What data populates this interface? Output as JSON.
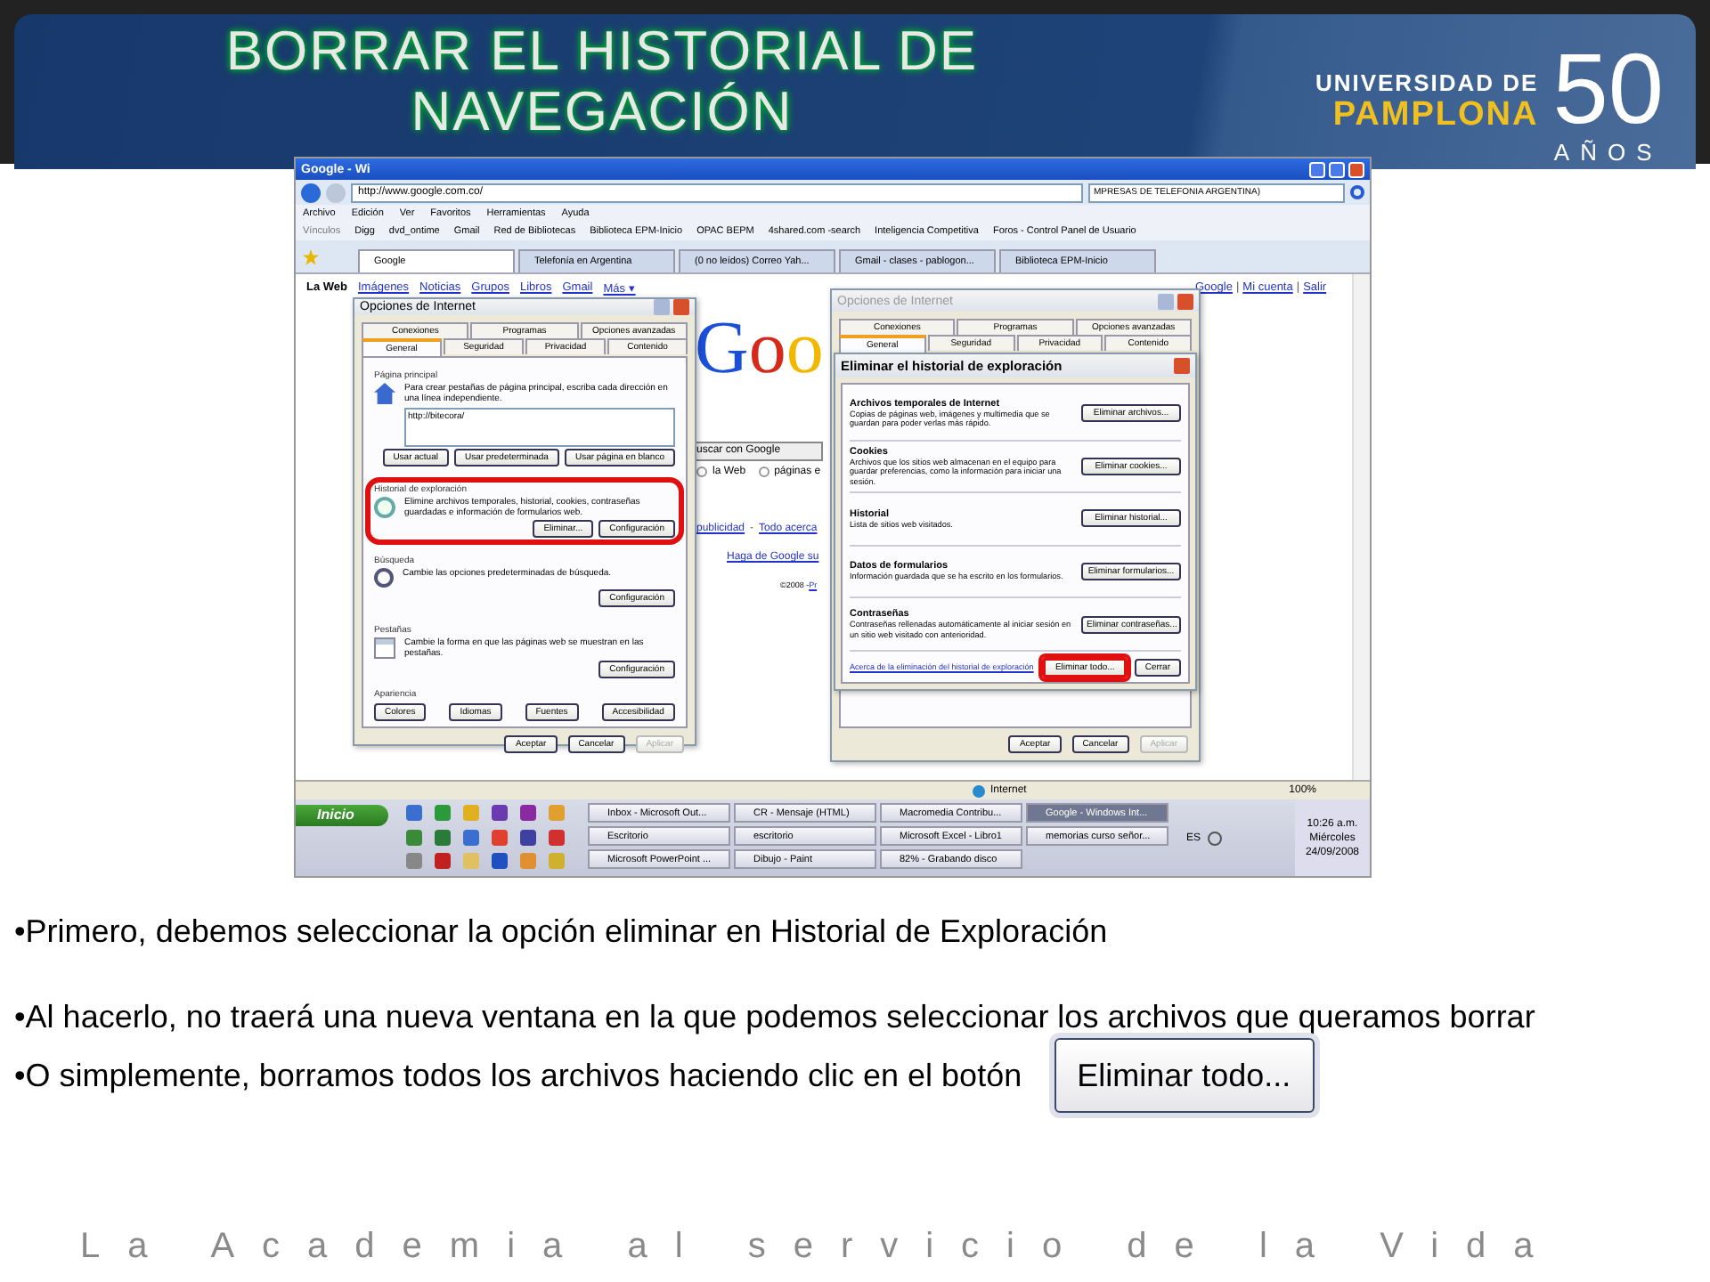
{
  "header": {
    "title": "BORRAR EL HISTORIAL DE NAVEGACIÓN",
    "logo": {
      "line1": "UNIVERSIDAD DE",
      "line2": "PAMPLONA",
      "number": "50",
      "years": "AÑOS"
    }
  },
  "screenshot": {
    "browser": {
      "title": "Google - Wi",
      "address": "http://www.google.com.co/",
      "search": "MPRESAS DE TELEFONIA ARGENTINA)",
      "menu": [
        "Archivo",
        "Edición",
        "Ver",
        "Favoritos",
        "Herramientas",
        "Ayuda"
      ],
      "links_label": "Vínculos",
      "links": [
        "Digg",
        "dvd_ontime",
        "Gmail",
        "Red de Bibliotecas",
        "Biblioteca EPM-Inicio",
        "OPAC BEPM",
        "4shared.com -search",
        "Inteligencia Competitiva",
        "Foros - Control Panel de Usuario"
      ],
      "tabs": [
        {
          "label": "Google",
          "selected": true
        },
        {
          "label": "Telefonía en Argentina",
          "selected": false
        },
        {
          "label": "(0 no leídos) Correo Yah...",
          "selected": false
        },
        {
          "label": "Gmail - clases - pablogon...",
          "selected": false
        },
        {
          "label": "Biblioteca EPM-Inicio",
          "selected": false
        }
      ],
      "status": "Internet",
      "zoom": "100%"
    },
    "page": {
      "nav": [
        {
          "label": "La Web",
          "selected": true
        },
        {
          "label": "Imágenes",
          "selected": false
        },
        {
          "label": "Noticias",
          "selected": false
        },
        {
          "label": "Grupos",
          "selected": false
        },
        {
          "label": "Libros",
          "selected": false
        },
        {
          "label": "Gmail",
          "selected": false
        },
        {
          "label": "Más ▾",
          "selected": false
        }
      ],
      "account_links": [
        "Google",
        "Mi cuenta",
        "Salir"
      ],
      "account_separator": "|",
      "logo": "Goo",
      "search_button": "uscar con Google",
      "radios": [
        {
          "label": "la Web",
          "selected": false
        },
        {
          "label": "páginas e",
          "selected": false
        }
      ],
      "links": [
        "publicidad",
        "Todo acerca"
      ],
      "link_separator": "-",
      "homepage_link": "Haga de Google su",
      "copyright": "©2008 - ",
      "copyright_link": "Pr"
    },
    "dialogs": [
      {
        "kind": "options",
        "title": "Opciones de Internet",
        "active": true,
        "tab_rows": [
          [
            {
              "label": "Conexiones",
              "selected": false
            },
            {
              "label": "Programas",
              "selected": false
            },
            {
              "label": "Opciones avanzadas",
              "selected": false
            }
          ],
          [
            {
              "label": "General",
              "selected": true
            },
            {
              "label": "Seguridad",
              "selected": false
            },
            {
              "label": "Privacidad",
              "selected": false
            },
            {
              "label": "Contenido",
              "selected": false
            }
          ]
        ],
        "sections": [
          {
            "heading": "Página principal",
            "text": "Para crear pestañas de página principal, escriba cada dirección en una línea independiente.",
            "value": "http://bitecora/",
            "buttons": [
              "Usar actual",
              "Usar predeterminada",
              "Usar página en blanco"
            ],
            "highlighted": false
          },
          {
            "heading": "Historial de exploración",
            "text": "Elimine archivos temporales, historial, cookies, contraseñas guardadas e información de formularios web.",
            "buttons": [
              "Eliminar...",
              "Configuración"
            ],
            "highlighted": true
          },
          {
            "heading": "Búsqueda",
            "text": "Cambie las opciones predeterminadas de búsqueda.",
            "buttons": [
              "Configuración"
            ],
            "highlighted": false
          },
          {
            "heading": "Pestañas",
            "text": "Cambie la forma en que las páginas web se muestran en las pestañas.",
            "buttons": [
              "Configuración"
            ],
            "highlighted": false
          }
        ],
        "appearance": {
          "heading": "Apariencia",
          "buttons": [
            "Colores",
            "Idiomas",
            "Fuentes",
            "Accesibilidad"
          ]
        },
        "footer": [
          {
            "label": "Aceptar",
            "disabled": false
          },
          {
            "label": "Cancelar",
            "disabled": false
          },
          {
            "label": "Aplicar",
            "disabled": true
          }
        ]
      },
      {
        "kind": "options_behind",
        "title": "Opciones de Internet",
        "active": false,
        "tab_rows": [
          [
            {
              "label": "Conexiones",
              "selected": false
            },
            {
              "label": "Programas",
              "selected": false
            },
            {
              "label": "Opciones avanzadas",
              "selected": false
            }
          ],
          [
            {
              "label": "General",
              "selected": true
            },
            {
              "label": "Seguridad",
              "selected": false
            },
            {
              "label": "Privacidad",
              "selected": false
            },
            {
              "label": "Contenido",
              "selected": false
            }
          ]
        ],
        "footer": [
          {
            "label": "Aceptar",
            "disabled": false
          },
          {
            "label": "Cancelar",
            "disabled": false
          },
          {
            "label": "Aplicar",
            "disabled": true
          }
        ]
      },
      {
        "kind": "delete_history",
        "title": "Eliminar el historial de exploración",
        "active": true,
        "sections": [
          {
            "heading": "Archivos temporales de Internet",
            "text": "Copias de páginas web, imágenes y multimedia que se guardan para poder verlas más rápido.",
            "button": "Eliminar archivos..."
          },
          {
            "heading": "Cookies",
            "text": "Archivos que los sitios web almacenan en el equipo para guardar preferencias, como la información para iniciar una sesión.",
            "button": "Eliminar cookies..."
          },
          {
            "heading": "Historial",
            "text": "Lista de sitios web visitados.",
            "button": "Eliminar historial..."
          },
          {
            "heading": "Datos de formularios",
            "text": "Información guardada que se ha escrito en los formularios.",
            "button": "Eliminar formularios..."
          },
          {
            "heading": "Contraseñas",
            "text": "Contraseñas rellenadas automáticamente al iniciar sesión en un sitio web visitado con anterioridad.",
            "button": "Eliminar contraseñas..."
          }
        ],
        "link": "Acerca de la eliminación del historial de exploración",
        "buttons": [
          {
            "label": "Eliminar todo...",
            "highlighted": true
          },
          {
            "label": "Cerrar",
            "highlighted": false
          }
        ]
      }
    ],
    "taskbar": {
      "start": "Inicio",
      "tasks": [
        {
          "label": "Inbox - Microsoft Out...",
          "selected": false
        },
        {
          "label": "CR - Mensaje (HTML)",
          "selected": false
        },
        {
          "label": "Macromedia Contribu...",
          "selected": false
        },
        {
          "label": "Google - Windows Int...",
          "selected": true
        },
        {
          "label": "Escritorio",
          "selected": false
        },
        {
          "label": "escritorio",
          "selected": false
        },
        {
          "label": "Microsoft Excel - Libro1",
          "selected": false
        },
        {
          "label": "memorias curso señor...",
          "selected": false
        },
        {
          "label": "Microsoft PowerPoint ...",
          "selected": false
        },
        {
          "label": "Dibujo - Paint",
          "selected": false
        },
        {
          "label": "82% - Grabando disco",
          "selected": false
        }
      ],
      "language": "ES",
      "time": "10:26 a.m.",
      "day": "Miércoles",
      "date": "24/09/2008"
    }
  },
  "bullets": [
    {
      "text": "•Primero, debemos seleccionar la opción eliminar en Historial de Exploración"
    },
    {
      "text": "•Al hacerlo, no traerá una nueva ventana en la que podemos seleccionar los archivos que queramos borrar"
    },
    {
      "text": "•O simplemente, borramos todos los archivos haciendo clic en el botón",
      "button": "Eliminar todo..."
    }
  ],
  "motto": "La Academia al servicio de la Vida"
}
